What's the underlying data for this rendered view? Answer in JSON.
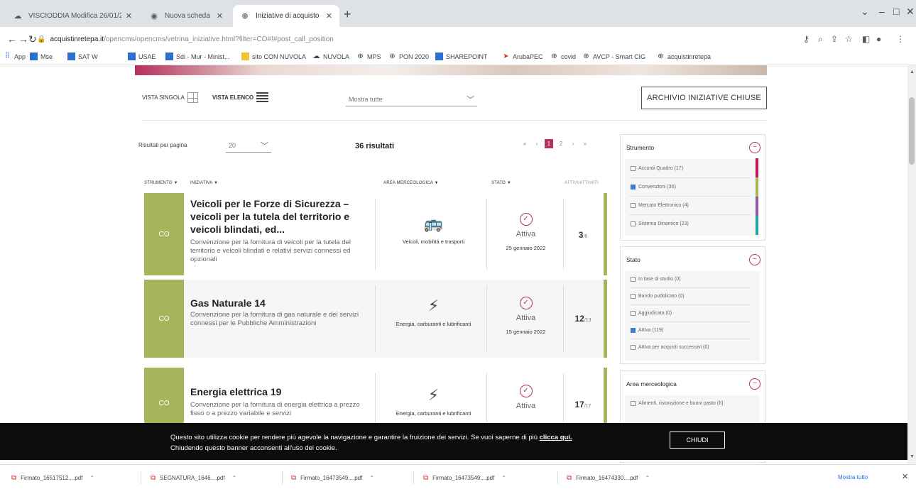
{
  "browser": {
    "tabs": [
      {
        "label": "VISCIODDIA Modifica 26/01/202",
        "icon": "cloud-icon"
      },
      {
        "label": "Nuova scheda",
        "icon": "chrome-icon"
      },
      {
        "label": "Iniziative di acquisto - acquistin",
        "icon": "globe-icon"
      }
    ],
    "address": {
      "domain": "acquistinretepa.it",
      "path": "/opencms/opencms/vetrina_iniziative.html?filter=CO#!#post_call_position"
    },
    "bookmarks": [
      "App",
      "Mse",
      "SAT W",
      "USAE",
      "Sdi - Mur - Minist...",
      "sito CON NUVOLA",
      "NUVOLA",
      "MPS",
      "PON 2020",
      "SHAREPOINT",
      "ArubaPEC",
      "covid",
      "AVCP - Smart CIG",
      "acquistinretepa"
    ]
  },
  "toolbar": {
    "view_single": "VISTA SINGOLA",
    "view_list": "VISTA ELENCO",
    "sort_placeholder": "Mostra tutte",
    "archive_button": "ARCHIVIO INIZIATIVE CHIUSE",
    "results_per_page_label": "Risultati per pagina",
    "results_per_page_value": "20",
    "results_count": "36 risultati",
    "pagination": {
      "current": "1",
      "next": "2"
    }
  },
  "table_headers": [
    "STRUMENTO",
    "INIZIATIVA",
    "AREA MERCEOLOGICA",
    "STATO",
    "ATTIVI/ATTIVATI"
  ],
  "initiatives": [
    {
      "code": "CO",
      "title": "Veicoli per le Forze di Sicurezza – veicoli per la tutela del territorio e veicoli blindati, ed...",
      "description": "Convenzione per la fornitura di veicoli per la tutela del territorio e veicoli blindati e relativi servizi connessi ed opzionali",
      "category": "Veicoli, mobilità e trasporti",
      "category_icon": "bus-icon",
      "status": "Attiva",
      "date": "25 gennaio 2022",
      "count": "3",
      "count_total": "/6"
    },
    {
      "code": "CO",
      "title": "Gas Naturale 14",
      "description": "Convenzione per la fornitura di gas naturale e dei servizi connessi per le Pubbliche Amministrazioni",
      "category": "Energia, carburanti e lubrificanti",
      "category_icon": "power-pylon-icon",
      "status": "Attiva",
      "date": "15 gennaio 2022",
      "count": "12",
      "count_total": "/13"
    },
    {
      "code": "CO",
      "title": "Energia elettrica 19",
      "description": "Convenzione per la fornitura di energia elettrica a prezzo fisso o a prezzo variabile e servizi",
      "category": "Energia, carburanti e lubrificanti",
      "category_icon": "power-pylon-icon",
      "status": "Attiva",
      "date": "",
      "count": "17",
      "count_total": "/17"
    }
  ],
  "filters": {
    "strumento": {
      "title": "Strumento",
      "items": [
        {
          "label": "Accordi Quadro (17)",
          "checked": false,
          "color": "#c2185b"
        },
        {
          "label": "Convenzioni (36)",
          "checked": true,
          "color": "#a7b55a"
        },
        {
          "label": "Mercato Elettronico (4)",
          "checked": false,
          "color": "#8e5aa8"
        },
        {
          "label": "Sistema Dinamico (23)",
          "checked": false,
          "color": "#1fa3a3"
        }
      ]
    },
    "stato": {
      "title": "Stato",
      "items": [
        {
          "label": "In fase di studio (0)",
          "checked": false
        },
        {
          "label": "Bando pubblicato (0)",
          "checked": false
        },
        {
          "label": "Aggiudicata (0)",
          "checked": false
        },
        {
          "label": "Attiva (119)",
          "checked": true
        },
        {
          "label": "Attiva per acquisti successivi (0)",
          "checked": false
        }
      ]
    },
    "area": {
      "title": "Area merceologica",
      "items": [
        {
          "label": "Alimenti, ristorazione e buoni pasto (6)",
          "checked": false
        }
      ]
    }
  },
  "cookie": {
    "text": "Questo sito utilizza cookie per rendere più agevole la navigazione e garantire la fruizione dei servizi. Se vuoi saperne di più",
    "link": "clicca qui.",
    "text2": "Chiudendo questo banner acconsenti all'uso dei cookie.",
    "button": "CHIUDI"
  },
  "downloads": {
    "items": [
      "Firmato_16517512....pdf",
      "SEGNATURA_1646....pdf",
      "Firmato_16473549....pdf",
      "Firmato_16473549....pdf",
      "Firmato_16474330....pdf"
    ],
    "show_all": "Mostra tutto"
  }
}
